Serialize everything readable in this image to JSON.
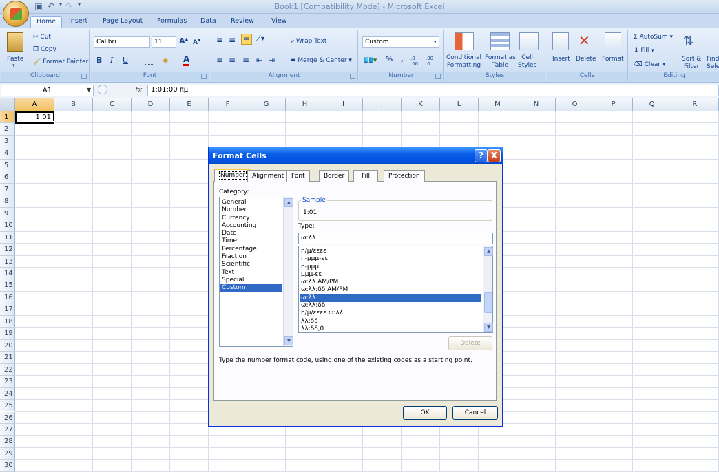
{
  "window": {
    "title": "Book1  [Compatibility Mode] - Microsoft Excel"
  },
  "ribbon": {
    "tabs": [
      "Home",
      "Insert",
      "Page Layout",
      "Formulas",
      "Data",
      "Review",
      "View"
    ],
    "clipboard": {
      "paste": "Paste",
      "cut": "Cut",
      "copy": "Copy",
      "format_painter": "Format Painter",
      "label": "Clipboard"
    },
    "font": {
      "name": "Calibri",
      "size": "11",
      "label": "Font"
    },
    "alignment": {
      "wrap_text": "Wrap Text",
      "merge_center": "Merge & Center",
      "label": "Alignment"
    },
    "number": {
      "format": "Custom",
      "label": "Number"
    },
    "styles": {
      "conditional_formatting": "Conditional\nFormatting",
      "format_as_table": "Format as\nTable",
      "cell_styles": "Cell\nStyles",
      "label": "Styles"
    },
    "cells": {
      "insert": "Insert",
      "delete": "Delete",
      "format": "Format",
      "label": "Cells"
    },
    "editing": {
      "autosum": "AutoSum",
      "fill": "Fill",
      "clear": "Clear",
      "sort_filter": "Sort &\nFilter",
      "find_select": "Find\nSele",
      "label": "Editing"
    }
  },
  "formula_bar": {
    "name_box": "A1",
    "fx": "fx",
    "formula": "1:01:00 πμ"
  },
  "grid": {
    "columns": [
      "A",
      "B",
      "C",
      "D",
      "E",
      "F",
      "G",
      "H",
      "I",
      "J",
      "K",
      "L",
      "M",
      "N",
      "O",
      "P",
      "Q",
      "R"
    ],
    "rows": [
      "1",
      "2",
      "3",
      "4",
      "5",
      "6",
      "7",
      "8",
      "9",
      "10",
      "11",
      "12",
      "13",
      "14",
      "15",
      "16",
      "17",
      "18",
      "19",
      "20",
      "21",
      "22",
      "23",
      "24",
      "25",
      "26",
      "27",
      "28",
      "29",
      "30"
    ],
    "a1_value": "1:01"
  },
  "dialog": {
    "title": "Format Cells",
    "help_button": "?",
    "close_button": "X",
    "tabs": [
      "Number",
      "Alignment",
      "Font",
      "Border",
      "Fill",
      "Protection"
    ],
    "category_label": "Category:",
    "categories": [
      "General",
      "Number",
      "Currency",
      "Accounting",
      "Date",
      "Time",
      "Percentage",
      "Fraction",
      "Scientific",
      "Text",
      "Special",
      "Custom"
    ],
    "selected_category": "Custom",
    "sample_label": "Sample",
    "sample_value": "1:01",
    "type_label": "Type:",
    "type_value": "ω:λλ",
    "type_list": [
      "η/μ/εεεε",
      "η-μμμ-εε",
      "η-μμμ",
      "μμμ-εε",
      "ω:λλ AM/PM",
      "ω:λλ:δδ AM/PM",
      "ω:λλ",
      "ω:λλ:δδ",
      "η/μ/εεεε ω:λλ",
      "λλ:δδ",
      "λλ:δδ,0"
    ],
    "selected_type": "ω:λλ",
    "delete_button": "Delete",
    "description": "Type the number format code, using one of the existing codes as a starting point.",
    "ok_button": "OK",
    "cancel_button": "Cancel"
  }
}
